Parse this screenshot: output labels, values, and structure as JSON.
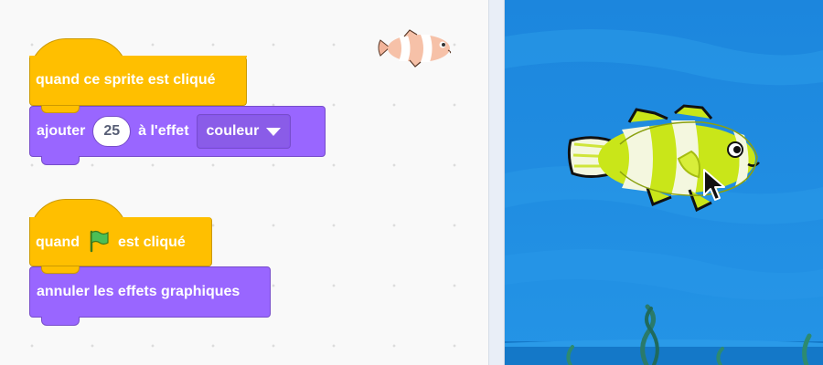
{
  "script1": {
    "hat_label": "quand ce sprite est cliqué",
    "stack_prefix": "ajouter",
    "stack_value": "25",
    "stack_middle": "à l'effet",
    "stack_dropdown": "couleur"
  },
  "script2": {
    "hat_prefix": "quand",
    "hat_suffix": "est cliqué",
    "stack_label": "annuler les effets graphiques"
  },
  "colors": {
    "events": "#ffbf00",
    "looks": "#9966ff",
    "stage_water": "#1f8fe0",
    "fish_body": "#c8e619"
  },
  "icons": [
    "green-flag-icon",
    "clownfish-sprite-thumbnail",
    "clownfish-sprite",
    "mouse-pointer-icon",
    "seaweed"
  ]
}
